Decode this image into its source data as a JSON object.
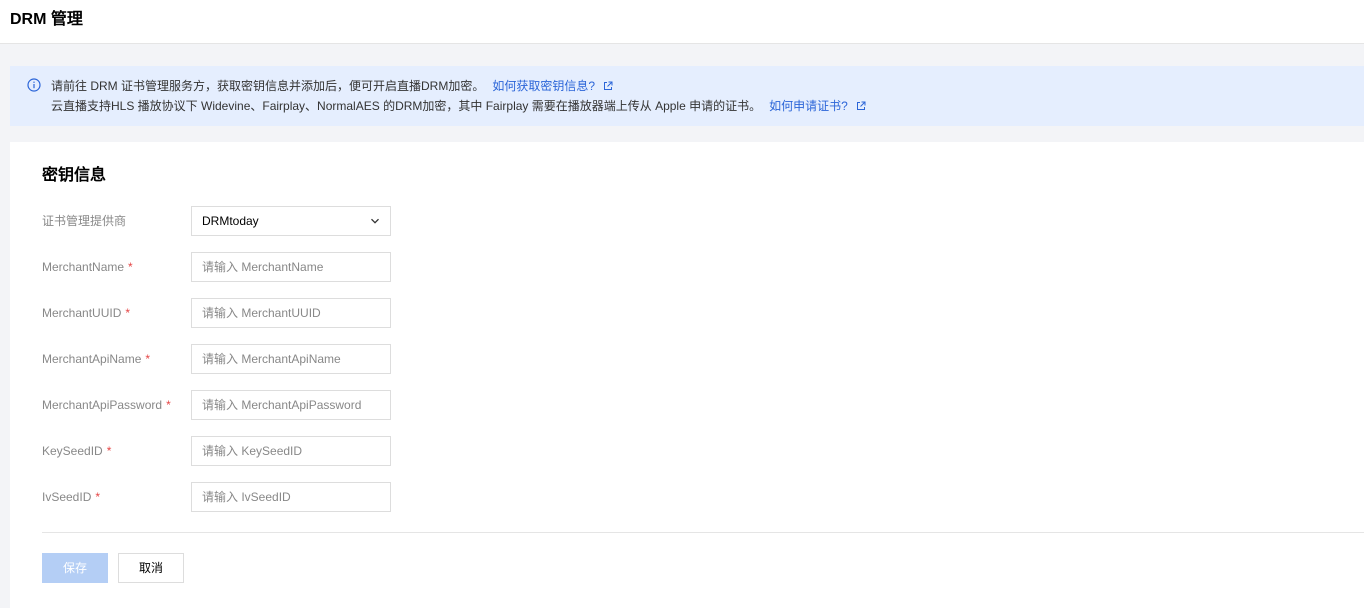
{
  "header": {
    "title": "DRM 管理"
  },
  "notice": {
    "line1_text": "请前往 DRM 证书管理服务方，获取密钥信息并添加后，便可开启直播DRM加密。",
    "line1_link": "如何获取密钥信息?",
    "line2_text": "云直播支持HLS 播放协议下 Widevine、Fairplay、NormalAES 的DRM加密，其中 Fairplay 需要在播放器端上传从 Apple 申请的证书。",
    "line2_link": "如何申请证书?"
  },
  "form": {
    "title": "密钥信息",
    "provider": {
      "label": "证书管理提供商",
      "value": "DRMtoday"
    },
    "fields": [
      {
        "label": "MerchantName",
        "placeholder": "请输入 MerchantName"
      },
      {
        "label": "MerchantUUID",
        "placeholder": "请输入 MerchantUUID"
      },
      {
        "label": "MerchantApiName",
        "placeholder": "请输入 MerchantApiName"
      },
      {
        "label": "MerchantApiPassword",
        "placeholder": "请输入 MerchantApiPassword"
      },
      {
        "label": "KeySeedID",
        "placeholder": "请输入 KeySeedID"
      },
      {
        "label": "IvSeedID",
        "placeholder": "请输入 IvSeedID"
      }
    ],
    "required_mark": "*"
  },
  "actions": {
    "save_label": "保存",
    "cancel_label": "取消"
  },
  "colors": {
    "link": "#2b65d8",
    "notice_bg": "#e5eefe",
    "required": "#e54545",
    "save_disabled": "#b4cef5"
  },
  "icons": {
    "info": "info-icon",
    "external": "external-link-icon",
    "chevron": "chevron-down-icon"
  }
}
